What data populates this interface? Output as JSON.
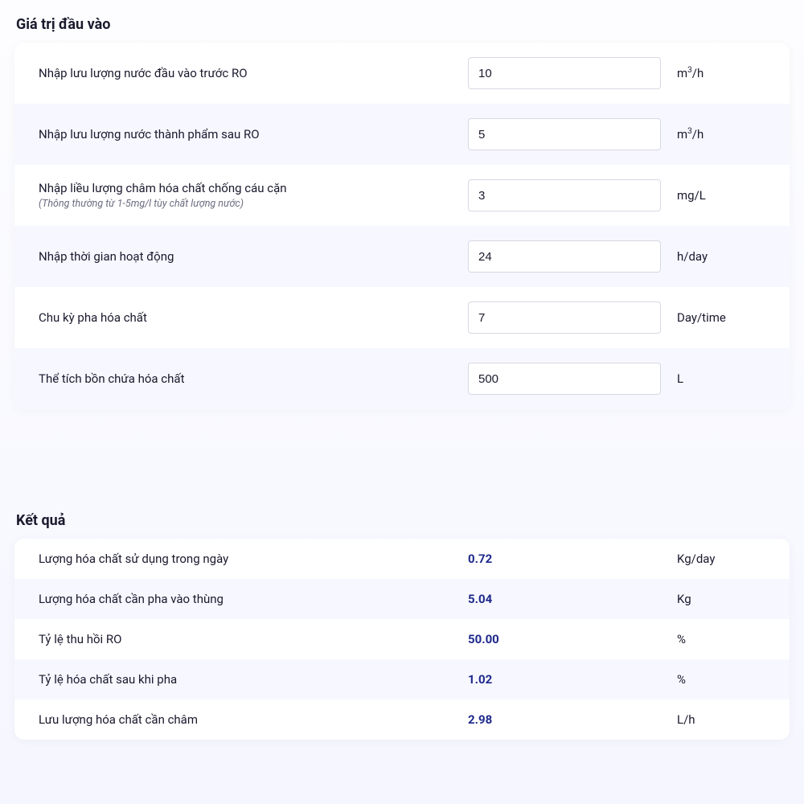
{
  "inputs_section": {
    "title": "Giá trị đầu vào",
    "rows": [
      {
        "label": "Nhập lưu lượng nước đầu vào trước RO",
        "hint": "",
        "value": "10",
        "unit_html": "m<sup>3</sup>/h"
      },
      {
        "label": "Nhập lưu lượng nước thành phẩm sau RO",
        "hint": "",
        "value": "5",
        "unit_html": "m<sup>3</sup>/h"
      },
      {
        "label": "Nhập liều lượng châm hóa chất chống cáu cặn",
        "hint": "(Thông thường từ 1-5mg/l tùy chất lượng nước)",
        "value": "3",
        "unit_html": "mg/L"
      },
      {
        "label": "Nhập thời gian hoạt động",
        "hint": "",
        "value": "24",
        "unit_html": "h/day"
      },
      {
        "label": "Chu kỳ pha hóa chất",
        "hint": "",
        "value": "7",
        "unit_html": "Day/time"
      },
      {
        "label": "Thể tích bồn chứa hóa chất",
        "hint": "",
        "value": "500",
        "unit_html": "L"
      }
    ]
  },
  "results_section": {
    "title": "Kết quả",
    "rows": [
      {
        "label": "Lượng hóa chất sử dụng trong ngày",
        "value": "0.72",
        "unit": "Kg/day"
      },
      {
        "label": "Lượng hóa chất cần pha vào thùng",
        "value": "5.04",
        "unit": "Kg"
      },
      {
        "label": "Tỷ lệ thu hồi RO",
        "value": "50.00",
        "unit": "%"
      },
      {
        "label": "Tỷ lệ hóa chất sau khi pha",
        "value": "1.02",
        "unit": "%"
      },
      {
        "label": "Lưu lượng hóa chất cần châm",
        "value": "2.98",
        "unit": "L/h"
      }
    ]
  }
}
